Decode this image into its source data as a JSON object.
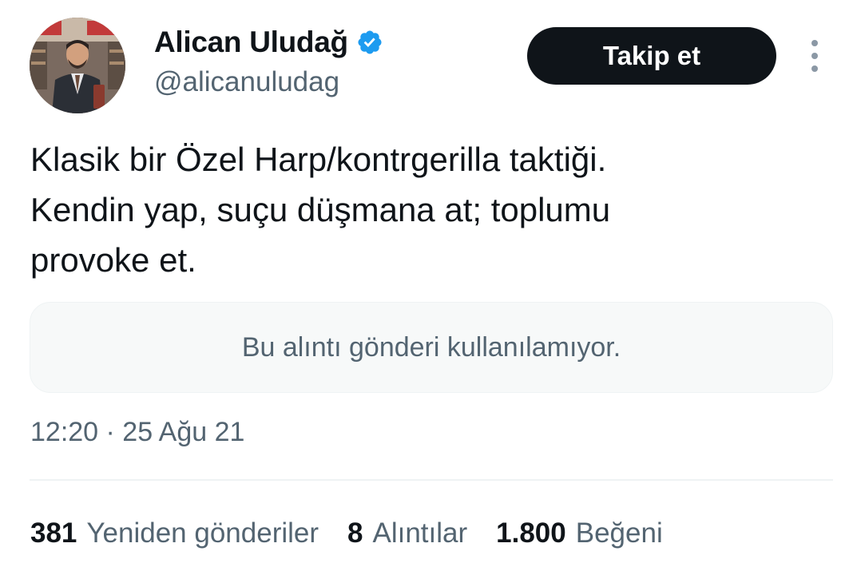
{
  "author": {
    "display_name": "Alican Uludağ",
    "handle": "@alicanuludag",
    "verified": true,
    "verified_color": "#1d9bf0"
  },
  "follow_button": {
    "label": "Takip et"
  },
  "tweet": {
    "lines": [
      "Klasik bir Özel Harp/kontrgerilla taktiği.",
      "Kendin yap, suçu düşmana at; toplumu",
      "provoke et."
    ],
    "quote_unavailable": "Bu alıntı gönderi kullanılamıyor.",
    "timestamp": "12:20 · 25 Ağu 21"
  },
  "stats": {
    "retweets": {
      "count": "381",
      "label": "Yeniden gönderiler"
    },
    "quotes": {
      "count": "8",
      "label": "Alıntılar"
    },
    "likes": {
      "count": "1.800",
      "label": "Beğeni"
    }
  },
  "icons": {
    "verified": "verified-badge-icon",
    "more": "more-options-icon"
  },
  "colors": {
    "text_primary": "#0f1419",
    "text_secondary": "#536471",
    "button_bg": "#0f1419",
    "quote_bg": "#f7f9f9"
  }
}
